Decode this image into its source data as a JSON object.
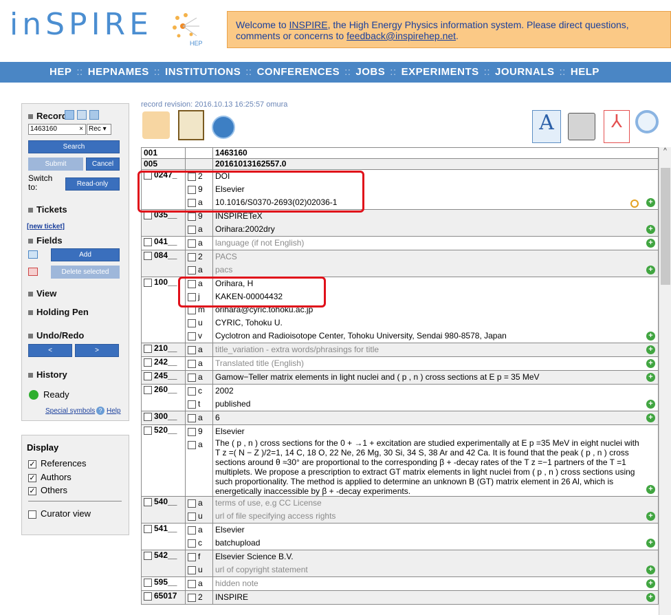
{
  "logo": "inSPIRE",
  "logo_sub": "HEP",
  "welcome": {
    "pre": "Welcome to ",
    "link1": "INSPIRE",
    "mid": ", the High Energy Physics information system. Please direct questions, comments or concerns to ",
    "link2": "feedback@inspirehep.net",
    "post": "."
  },
  "nav": [
    "HEP",
    "HEPNAMES",
    "INSTITUTIONS",
    "CONFERENCES",
    "JOBS",
    "EXPERIMENTS",
    "JOURNALS",
    "HELP"
  ],
  "left": {
    "record": "Record",
    "record_value": "1463160",
    "rec_select": "Rec",
    "search": "Search",
    "submit": "Submit",
    "cancel": "Cancel",
    "switch": "Switch to:",
    "readonly": "Read-only",
    "tickets": "Tickets",
    "new_ticket": "[new ticket]",
    "fields": "Fields",
    "add": "Add",
    "delete_selected": "Delete selected",
    "view": "View",
    "holding": "Holding Pen",
    "undo": "Undo/Redo",
    "undo_btn": "<",
    "redo_btn": ">",
    "history": "History",
    "ready": "Ready",
    "special": "Special symbols",
    "help": "Help"
  },
  "display": {
    "title": "Display",
    "references": "References",
    "authors": "Authors",
    "others": "Others",
    "curator": "Curator view"
  },
  "revision": "record revision: 2016.10.13 16:25:57 omura",
  "rows": [
    {
      "tag": "001",
      "subs": [
        {
          "c": "",
          "v": "1463160"
        }
      ]
    },
    {
      "tag": "005",
      "subs": [
        {
          "c": "",
          "v": "20161013162557.0"
        }
      ]
    },
    {
      "tag": "0247_",
      "subs": [
        {
          "c": "2",
          "v": "DOI"
        },
        {
          "c": "9",
          "v": "Elsevier"
        },
        {
          "c": "a",
          "v": "10.1016/S0370-2693(02)02036-1"
        }
      ]
    },
    {
      "tag": "035__",
      "subs": [
        {
          "c": "9",
          "v": "INSPIRETeX"
        },
        {
          "c": "a",
          "v": "Orihara:2002dry"
        }
      ]
    },
    {
      "tag": "041__",
      "subs": [
        {
          "c": "a",
          "v": "language (if not English)",
          "gray": true
        }
      ]
    },
    {
      "tag": "084__",
      "subs": [
        {
          "c": "2",
          "v": "PACS",
          "gray": true
        },
        {
          "c": "a",
          "v": "pacs",
          "gray": true
        }
      ]
    },
    {
      "tag": "100__",
      "subs": [
        {
          "c": "a",
          "v": "Orihara, H"
        },
        {
          "c": "j",
          "v": "KAKEN-00004432"
        },
        {
          "c": "m",
          "v": "orihara@cyric.tohoku.ac.jp"
        },
        {
          "c": "u",
          "v": "CYRIC, Tohoku U."
        },
        {
          "c": "v",
          "v": "Cyclotron and Radioisotope Center, Tohoku University, Sendai 980-8578, Japan"
        }
      ]
    },
    {
      "tag": "210__",
      "subs": [
        {
          "c": "a",
          "v": "title_variation - extra words/phrasings for title",
          "gray": true
        }
      ]
    },
    {
      "tag": "242__",
      "subs": [
        {
          "c": "a",
          "v": "Translated title (English)",
          "gray": true
        }
      ]
    },
    {
      "tag": "245__",
      "subs": [
        {
          "c": "a",
          "v": "Gamow−Teller matrix elements in light nuclei and ( p , n ) cross sections at E p = 35 MeV"
        }
      ]
    },
    {
      "tag": "260__",
      "subs": [
        {
          "c": "c",
          "v": "2002"
        },
        {
          "c": "t",
          "v": "published"
        }
      ]
    },
    {
      "tag": "300__",
      "subs": [
        {
          "c": "a",
          "v": "6"
        }
      ]
    },
    {
      "tag": "520__",
      "subs": [
        {
          "c": "9",
          "v": "Elsevier"
        },
        {
          "c": "a",
          "v": "The ( p , n ) cross sections for the 0 + →1 + excitation are studied experimentally at E p =35 MeV in eight nuclei with T z =( N − Z )/2=1, 14 C, 18 O, 22 Ne, 26 Mg, 30 Si, 34 S, 38 Ar and 42 Ca. It is found that the peak ( p , n ) cross sections around θ ≈30° are proportional to the corresponding β + -decay rates of the T z =−1 partners of the T =1 multiplets. We propose a prescription to extract GT matrix elements in light nuclei from ( p , n ) cross sections using such proportionality. The method is applied to determine an unknown B (GT) matrix element in 26 Al, which is energetically inaccessible by β + -decay experiments.",
          "wrap": true
        }
      ]
    },
    {
      "tag": "540__",
      "subs": [
        {
          "c": "a",
          "v": "terms of use, e.g CC License",
          "gray": true
        },
        {
          "c": "u",
          "v": "url of file specifying access rights",
          "gray": true
        }
      ]
    },
    {
      "tag": "541__",
      "subs": [
        {
          "c": "a",
          "v": "Elsevier"
        },
        {
          "c": "c",
          "v": "batchupload"
        }
      ]
    },
    {
      "tag": "542__",
      "subs": [
        {
          "c": "f",
          "v": "Elsevier Science B.V."
        },
        {
          "c": "u",
          "v": "url of copyright statement",
          "gray": true
        }
      ]
    },
    {
      "tag": "595__",
      "subs": [
        {
          "c": "a",
          "v": "hidden note",
          "gray": true
        }
      ]
    },
    {
      "tag": "65017",
      "subs": [
        {
          "c": "2",
          "v": "INSPIRE"
        }
      ]
    }
  ]
}
